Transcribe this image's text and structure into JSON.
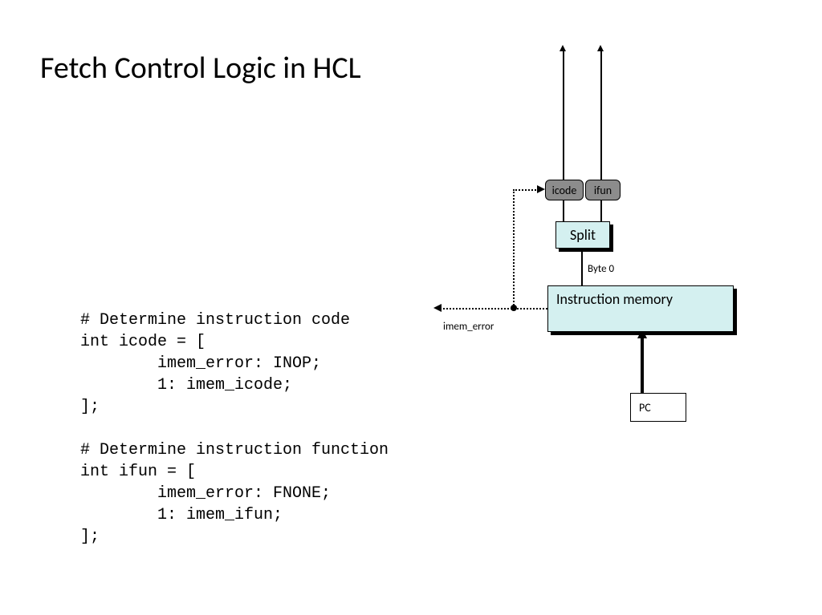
{
  "title": "Fetch Control Logic in HCL",
  "code": "# Determine instruction code\nint icode = [\n        imem_error: INOP;\n        1: imem_icode;\n];\n\n# Determine instruction function\nint ifun = [\n        imem_error: FNONE;\n        1: imem_ifun;\n];",
  "diagram": {
    "pc": "PC",
    "instruction_memory": "Instruction memory",
    "split": "Split",
    "icode": "icode",
    "ifun": "ifun",
    "byte0": "Byte 0",
    "imem_error": "imem_error"
  }
}
